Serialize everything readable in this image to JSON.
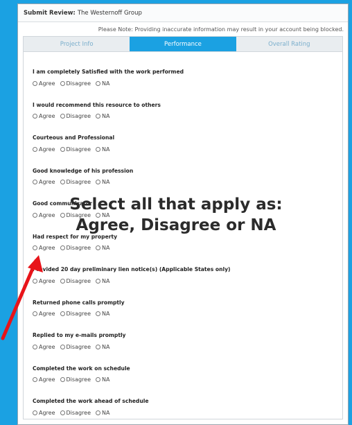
{
  "header": {
    "title_label": "Submit Review:",
    "title_value": "The Westernoff Group"
  },
  "note": "Please Note: Providing inaccurate information may result in your account being blocked.",
  "tabs": [
    {
      "label": "Project Info",
      "active": false
    },
    {
      "label": "Performance",
      "active": true
    },
    {
      "label": "Overall Rating",
      "active": false
    }
  ],
  "options": {
    "agree": "Agree",
    "disagree": "Disagree",
    "na": "NA"
  },
  "questions": [
    {
      "label": "I am completely Satisfied with the work performed"
    },
    {
      "label": "I would recommend this resource to others"
    },
    {
      "label": "Courteous and Professional"
    },
    {
      "label": "Good knowledge of his profession"
    },
    {
      "label": "Good communicator"
    },
    {
      "label": "Had respect for my property"
    },
    {
      "label": "Provided 20 day preliminary lien notice(s) (Applicable States only)"
    },
    {
      "label": "Returned phone calls promptly"
    },
    {
      "label": "Replied to my e-mails promptly"
    },
    {
      "label": "Completed the work on schedule"
    },
    {
      "label": "Completed the work ahead of schedule"
    }
  ],
  "overlay": {
    "line1": "Select all that apply as:",
    "line2": "Agree, Disagree or NA"
  },
  "colors": {
    "accent": "#1ba1e2",
    "arrow": "#e8141a"
  }
}
